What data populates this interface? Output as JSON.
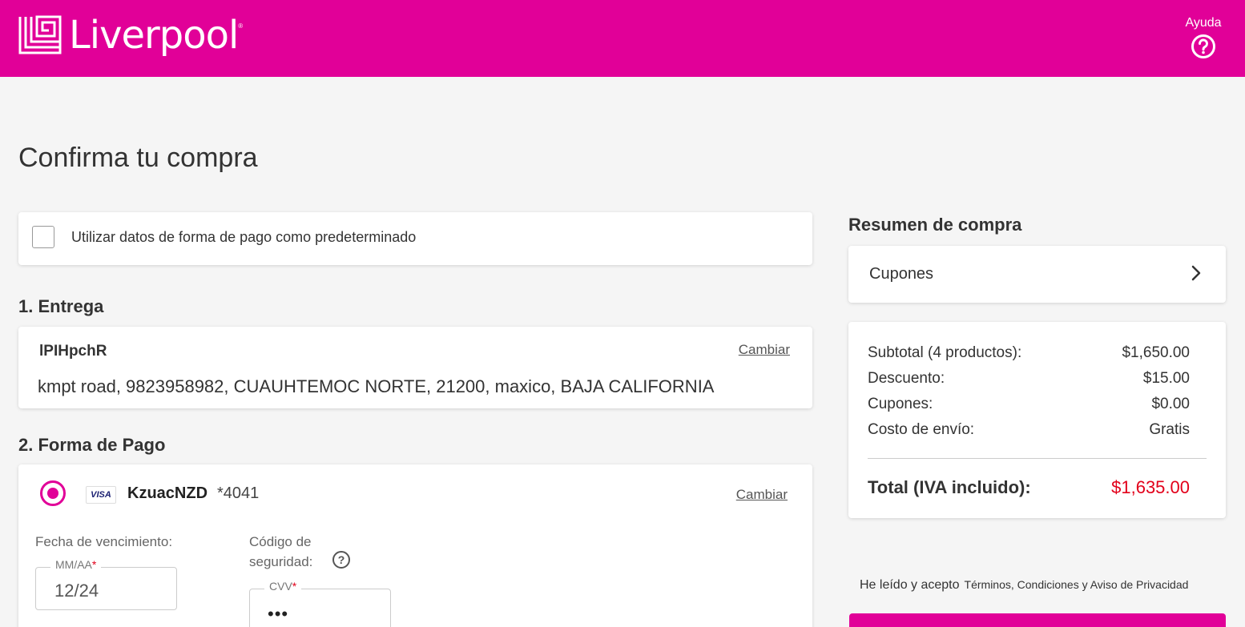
{
  "header": {
    "brand": "Liverpool",
    "help_label": "Ayuda",
    "help_icon": "question-circle-icon",
    "brand_color": "#e10098"
  },
  "page": {
    "title": "Confirma tu compra"
  },
  "default_payment": {
    "label": "Utilizar datos de forma de pago como predeterminado",
    "checked": false
  },
  "delivery": {
    "section_title": "1. Entrega",
    "recipient": "lPIHpchR",
    "address": "kmpt road, 9823958982, CUAUHTEMOC NORTE, 21200, maxico, BAJA CALIFORNIA",
    "change_label": "Cambiar"
  },
  "payment": {
    "section_title": "2. Forma de Pago",
    "card_brand": "VISA",
    "card_name": "KzuacNZD",
    "card_last4": "*4041",
    "change_label": "Cambiar",
    "selected": true,
    "expiry_caption": "Fecha de vencimiento:",
    "expiry_label": "MM/AA",
    "expiry_value": "12/24",
    "cvv_caption": "Código de seguridad:",
    "cvv_label": "CVV",
    "cvv_value": "•••",
    "required_marker": "*"
  },
  "summary": {
    "title": "Resumen de compra",
    "coupons_label": "Cupones",
    "rows": [
      {
        "label": "Subtotal (4 productos):",
        "value": "$1,650.00"
      },
      {
        "label": "Descuento:",
        "value": "$15.00"
      },
      {
        "label": "Cupones:",
        "value": "$0.00"
      },
      {
        "label": "Costo de envío:",
        "value": "Gratis"
      }
    ],
    "total_label": "Total (IVA incluido):",
    "total_value": "$1,635.00",
    "total_color": "#e2001a"
  },
  "terms": {
    "prefix": "He leído y acepto",
    "link": "Términos, Condiciones y Aviso de Privacidad"
  }
}
